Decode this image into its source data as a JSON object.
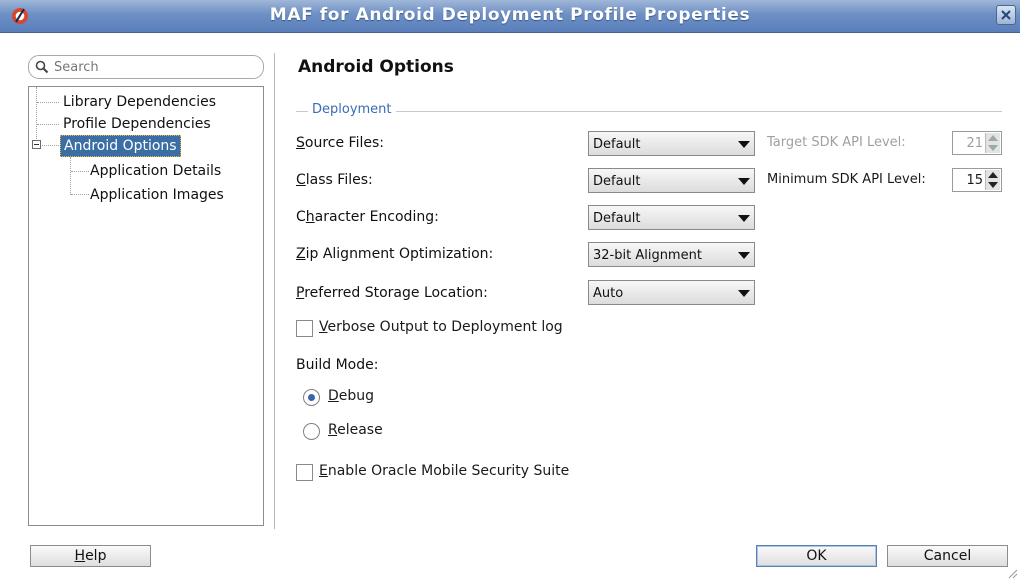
{
  "window": {
    "title": "MAF for Android Deployment Profile Properties"
  },
  "search": {
    "placeholder": "Search"
  },
  "nav": {
    "items": [
      {
        "label": "Library Dependencies"
      },
      {
        "label": "Profile Dependencies"
      },
      {
        "label": "Android Options",
        "selected": true,
        "expanded": true
      },
      {
        "label": "Application Details"
      },
      {
        "label": "Application Images"
      }
    ]
  },
  "content": {
    "section_title": "Android Options",
    "group_title": "Deployment",
    "fields": [
      {
        "mnemonic": "S",
        "rest": "ource Files:",
        "value": "Default"
      },
      {
        "mnemonic": "C",
        "rest": "lass Files:",
        "value": "Default"
      },
      {
        "pre": "C",
        "mnemonic": "h",
        "rest": "aracter Encoding:",
        "value": "Default"
      },
      {
        "mnemonic": "Z",
        "rest": "ip Alignment Optimization:",
        "value": "32-bit Alignment"
      },
      {
        "mnemonic": "P",
        "rest": "referred Storage Location:",
        "value": "Auto"
      }
    ],
    "target_sdk": {
      "mnemonic": "T",
      "rest": "arget SDK API Level:",
      "value": "21",
      "enabled": false
    },
    "min_sdk": {
      "mnemonic": "M",
      "rest": "inimum SDK API Level:",
      "value": "15",
      "enabled": true
    },
    "verbose": {
      "mnemonic": "V",
      "rest": "erbose Output to Deployment log",
      "checked": false
    },
    "build_mode": {
      "label": "Build Mode:",
      "options": [
        {
          "mnemonic": "D",
          "rest": "ebug",
          "checked": true
        },
        {
          "mnemonic": "R",
          "rest": "elease",
          "checked": false
        }
      ]
    },
    "security": {
      "mnemonic": "E",
      "rest": "nable Oracle Mobile Security Suite",
      "checked": false
    }
  },
  "buttons": {
    "help": {
      "mnemonic": "H",
      "rest": "elp"
    },
    "ok": "OK",
    "cancel": "Cancel"
  },
  "colors": {
    "titlebar": "#6d8fc4",
    "selection": "#3a6ea5",
    "group_title": "#3a6bb3"
  }
}
